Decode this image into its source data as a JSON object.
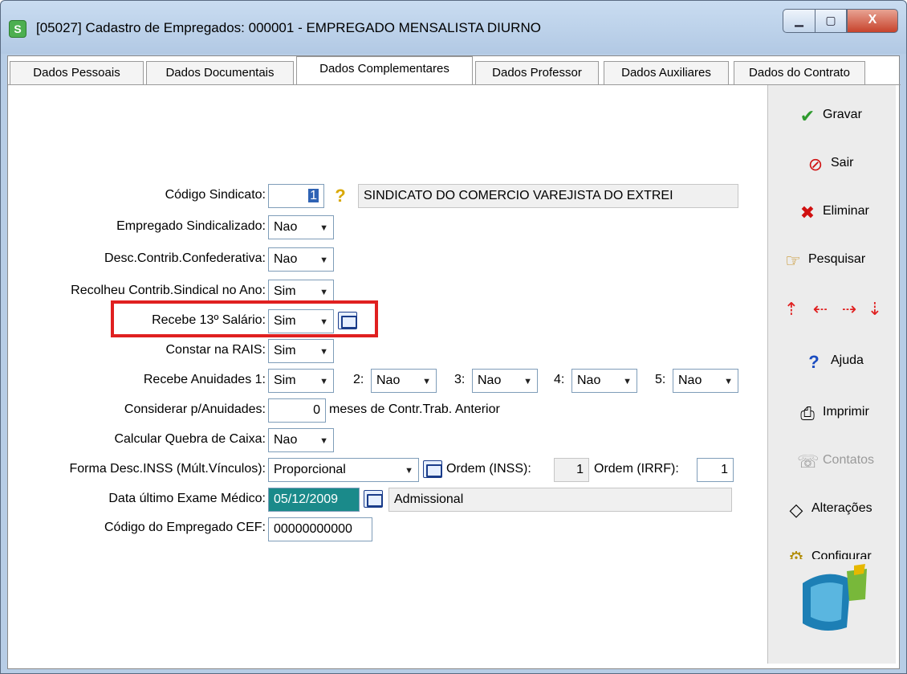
{
  "window": {
    "title": "[05027] Cadastro de Empregados: 000001 - EMPREGADO MENSALISTA DIURNO",
    "minimize": "▁",
    "maximize": "▢",
    "close": "X"
  },
  "tabs": [
    {
      "label": "Dados Pessoais",
      "active": false
    },
    {
      "label": "Dados Documentais",
      "active": false
    },
    {
      "label": "Dados Complementares",
      "active": true
    },
    {
      "label": "Dados Professor",
      "active": false
    },
    {
      "label": "Dados Auxiliares",
      "active": false
    },
    {
      "label": "Dados do Contrato",
      "active": false
    }
  ],
  "form": {
    "codigo_sindicato": {
      "label": "Código Sindicato:",
      "value": "1",
      "desc": "SINDICATO DO COMERCIO VAREJISTA DO EXTREI"
    },
    "empregado_sindicalizado": {
      "label": "Empregado Sindicalizado:",
      "value": "Nao"
    },
    "desc_contrib": {
      "label": "Desc.Contrib.Confederativa:",
      "value": "Nao"
    },
    "recolheu": {
      "label": "Recolheu Contrib.Sindical no Ano:",
      "value": "Sim"
    },
    "recebe_13": {
      "label": "Recebe 13º Salário:",
      "value": "Sim"
    },
    "constar_rais": {
      "label": "Constar na RAIS:",
      "value": "Sim"
    },
    "anuidades": {
      "label": "Recebe Anuidades 1:",
      "v1": "Sim",
      "l2": "2:",
      "v2": "Nao",
      "l3": "3:",
      "v3": "Nao",
      "l4": "4:",
      "v4": "Nao",
      "l5": "5:",
      "v5": "Nao"
    },
    "considerar": {
      "label": "Considerar p/Anuidades:",
      "value": "0",
      "suffix": "meses de Contr.Trab. Anterior"
    },
    "quebra_caixa": {
      "label": "Calcular Quebra de Caixa:",
      "value": "Nao"
    },
    "inss": {
      "label": "Forma Desc.INSS (Múlt.Vínculos):",
      "value": "Proporcional",
      "ordem_inss_label": "Ordem (INSS):",
      "ordem_inss": "1",
      "ordem_irrf_label": "Ordem (IRRF):",
      "ordem_irrf": "1"
    },
    "exame": {
      "label": "Data último Exame Médico:",
      "value": "05/12/2009",
      "tipo": "Admissional"
    },
    "cef": {
      "label": "Código do Empregado CEF:",
      "value": "00000000000"
    }
  },
  "sidebar": {
    "gravar": "Gravar",
    "sair": "Sair",
    "eliminar": "Eliminar",
    "pesquisar": "Pesquisar",
    "ajuda": "Ajuda",
    "imprimir": "Imprimir",
    "contatos": "Contatos",
    "alteracoes": "Alterações",
    "configurar": "Configurar"
  },
  "colors": {
    "accent": "#2f63b4",
    "highlight": "#e02020",
    "date_bg": "#1a8a8a"
  }
}
